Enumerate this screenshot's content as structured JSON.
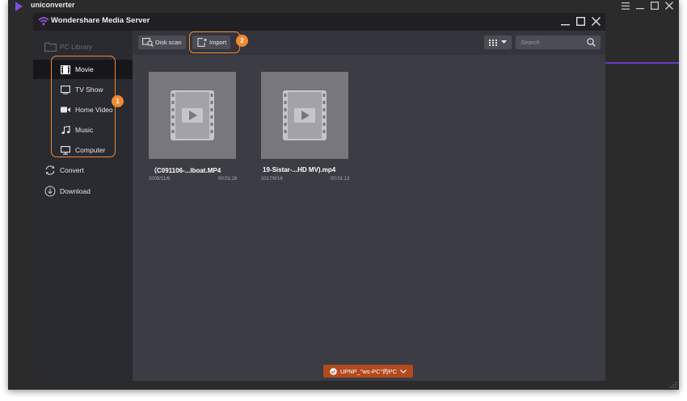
{
  "host": {
    "title": "uniconverter",
    "accent_color": "#6a3bbd"
  },
  "window": {
    "title": "Wondershare Media Server"
  },
  "sidebar": {
    "library_label": "PC Library",
    "items": [
      {
        "label": "Movie",
        "icon": "film-icon",
        "active": true
      },
      {
        "label": "TV Show",
        "icon": "tv-icon"
      },
      {
        "label": "Home Video",
        "icon": "video-camera-icon"
      },
      {
        "label": "Music",
        "icon": "music-note-icon"
      },
      {
        "label": "Computer",
        "icon": "monitor-icon"
      }
    ],
    "convert_label": "Convert",
    "download_label": "Download"
  },
  "toolbar": {
    "disk_scan_label": "Disk scan",
    "import_label": "Import",
    "search_placeholder": "Search"
  },
  "annotations": {
    "badge1": "1",
    "badge2": "2",
    "highlight_color": "#f08a32"
  },
  "media": [
    {
      "title": "（C091106-...lboat.MP4",
      "date": "2009/11/6",
      "duration": "00:01:28"
    },
    {
      "title": "19-Sistar-...HD MV).mp4",
      "date": "2017/9/16",
      "duration": "00:01:13"
    }
  ],
  "device": {
    "label": "UPNP_\"ws-PC\"的PC"
  }
}
